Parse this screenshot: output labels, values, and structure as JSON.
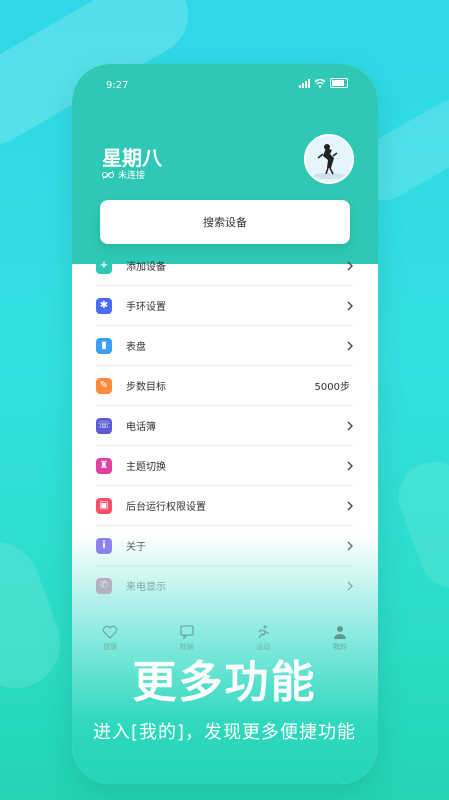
{
  "status_bar": {
    "time": "9:27"
  },
  "header": {
    "title": "星期八",
    "connection_status": "未连接"
  },
  "search": {
    "label": "搜索设备"
  },
  "menu": {
    "items": [
      {
        "label": "添加设备",
        "icon": "plus-icon",
        "color": "#2ec8b4",
        "value": ""
      },
      {
        "label": "手环设置",
        "icon": "gear-icon",
        "color": "#4a6cf7",
        "value": ""
      },
      {
        "label": "表盘",
        "icon": "watch-icon",
        "color": "#3aa0f0",
        "value": ""
      },
      {
        "label": "步数目标",
        "icon": "steps-icon",
        "color": "#ff8a3d",
        "value": "5000步"
      },
      {
        "label": "电话簿",
        "icon": "phonebook-icon",
        "color": "#5b5bd6",
        "value": ""
      },
      {
        "label": "主题切换",
        "icon": "shirt-icon",
        "color": "#e040a0",
        "value": ""
      },
      {
        "label": "后台运行权限设置",
        "icon": "lock-icon",
        "color": "#ff4d6a",
        "value": ""
      },
      {
        "label": "关于",
        "icon": "info-icon",
        "color": "#7a5cf0",
        "value": ""
      },
      {
        "label": "来电显示",
        "icon": "phone-icon",
        "color": "#e0407a",
        "value": ""
      }
    ]
  },
  "tabs": [
    {
      "label": "健康",
      "icon": "heart-icon"
    },
    {
      "label": "数据",
      "icon": "chat-icon"
    },
    {
      "label": "运动",
      "icon": "run-icon"
    },
    {
      "label": "我的",
      "icon": "person-icon"
    }
  ],
  "promo": {
    "headline": "更多功能",
    "subtitle": "进入[我的]，发现更多便捷功能"
  }
}
